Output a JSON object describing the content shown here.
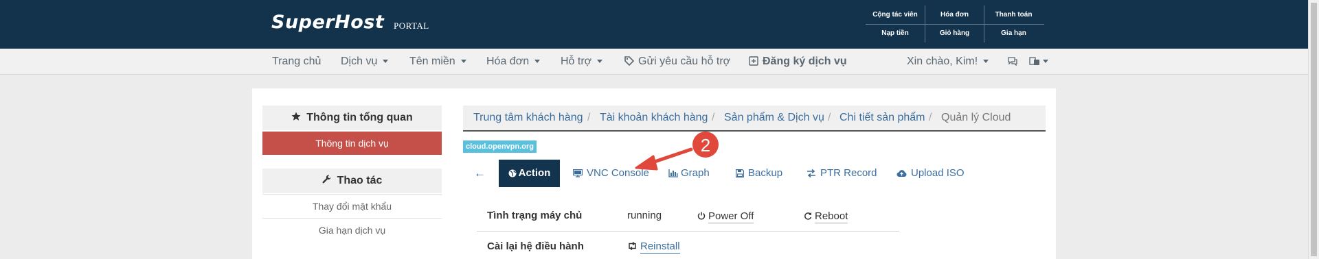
{
  "header": {
    "logo": "SuperHost",
    "logo_sub": "PORTAL",
    "quick_links": [
      [
        "Cộng tác viên",
        "Hóa đơn",
        "Thanh toán"
      ],
      [
        "Nạp tiền",
        "Giỏ hàng",
        "Gia hạn"
      ]
    ]
  },
  "nav": {
    "items": [
      "Trang chủ",
      "Dịch vụ",
      "Tên miền",
      "Hóa đơn",
      "Hỗ trợ",
      "Gửi yêu cầu hỗ trợ",
      "Đăng ký dịch vụ"
    ],
    "greeting": "Xin chào, Kim!",
    "icons": [
      "tag-icon",
      "plus-square-icon",
      "chat-icon",
      "language-icon"
    ]
  },
  "sidebar": {
    "overview_title": "Thông tin tổng quan",
    "overview_items": [
      "Thông tin dịch vụ"
    ],
    "actions_title": "Thao tác",
    "action_items": [
      "Thay đổi mật khẩu",
      "Gia hạn dịch vụ"
    ]
  },
  "breadcrumb": [
    "Trung tâm khách hàng",
    "Tài khoản khách hàng",
    "Sản phẩm & Dịch vụ",
    "Chi tiết sản phẩm",
    "Quản lý Cloud"
  ],
  "hostname": "cloud.openvpn.org",
  "tabs": {
    "back": "←",
    "items": [
      "Action",
      "VNC Console",
      "Graph",
      "Backup",
      "PTR Record",
      "Upload ISO"
    ],
    "active": "Action"
  },
  "server": {
    "status_label": "Tình trạng máy chủ",
    "status_value": "running",
    "power_off": "Power Off",
    "reboot": "Reboot",
    "reinstall_label": "Cài lại hệ điều hành",
    "reinstall": "Reinstall"
  },
  "annotation": {
    "number": "2",
    "color": "#e0483c"
  },
  "colors": {
    "header_bg": "#13334c",
    "active_sidebar": "#c5504a",
    "badge": "#5bc0de",
    "link": "#3b6e9e"
  }
}
